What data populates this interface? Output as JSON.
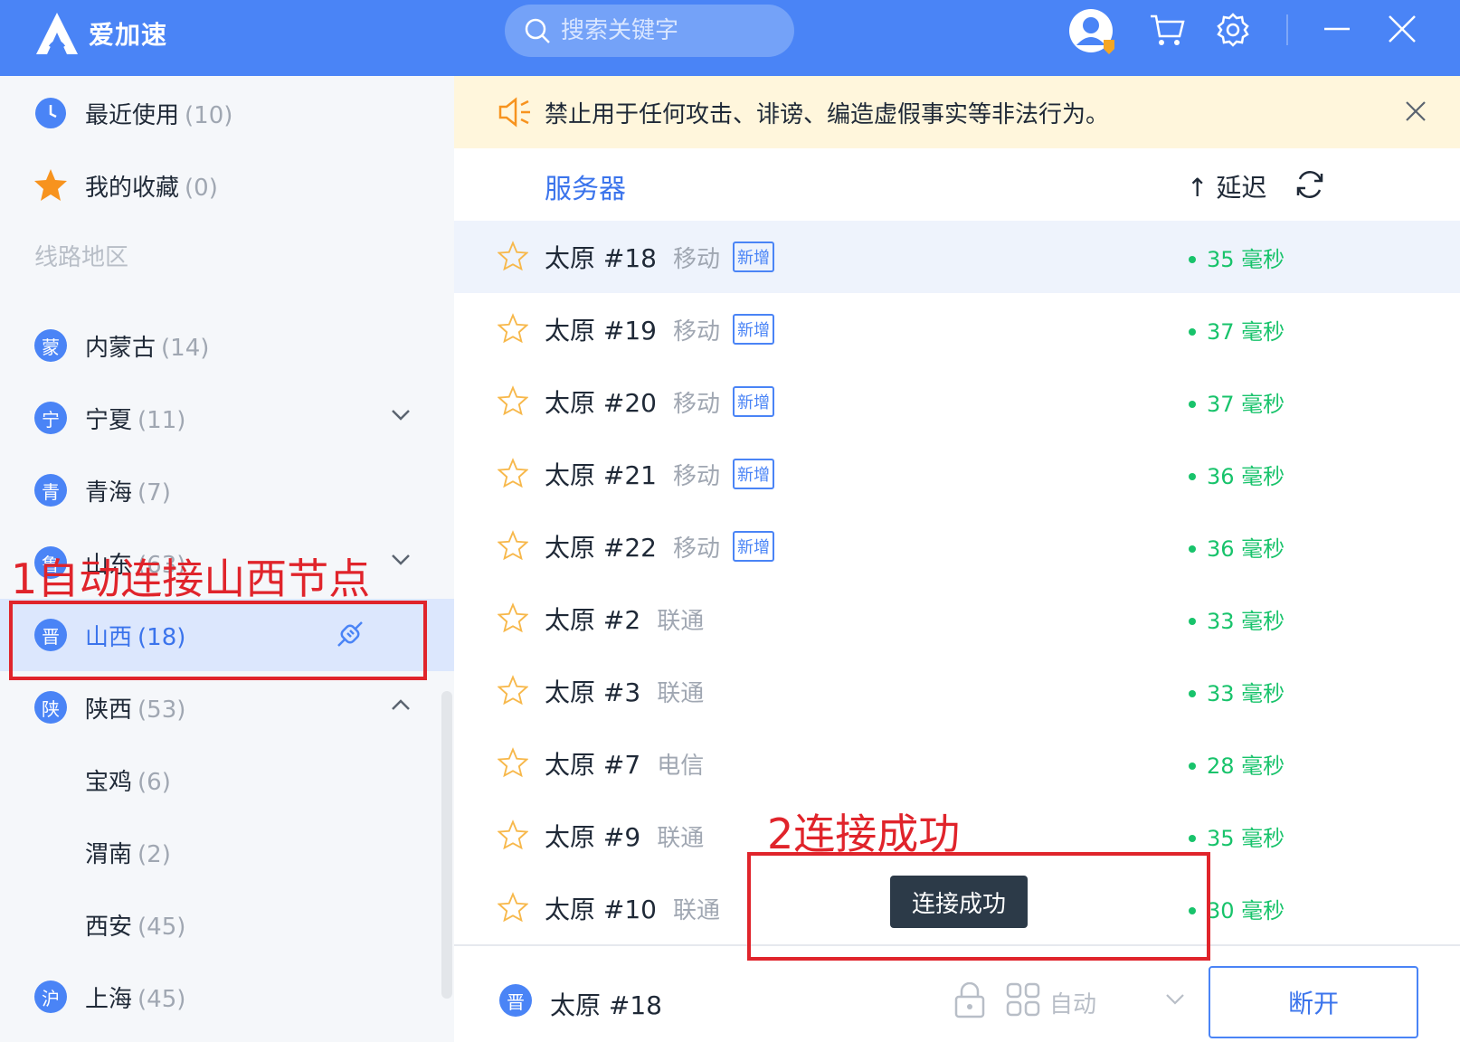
{
  "header": {
    "app_name": "爱加速",
    "search_placeholder": "搜索关键字"
  },
  "sidebar": {
    "recent": {
      "label": "最近使用",
      "count": "(10)"
    },
    "favorites": {
      "label": "我的收藏",
      "count": "(0)"
    },
    "section_title": "线路地区",
    "regions": [
      {
        "badge": "蒙",
        "label": "内蒙古",
        "count": "(14)"
      },
      {
        "badge": "宁",
        "label": "宁夏",
        "count": "(11)"
      },
      {
        "badge": "青",
        "label": "青海",
        "count": "(7)"
      },
      {
        "badge": "鲁",
        "label": "山东",
        "count": "(63)"
      },
      {
        "badge": "晋",
        "label": "山西",
        "count": "(18)"
      },
      {
        "badge": "陕",
        "label": "陕西",
        "count": "(53)"
      },
      {
        "badge": "沪",
        "label": "上海",
        "count": "(45)"
      }
    ],
    "sub_regions": [
      {
        "label": "宝鸡",
        "count": "(6)"
      },
      {
        "label": "渭南",
        "count": "(2)"
      },
      {
        "label": "西安",
        "count": "(45)"
      }
    ]
  },
  "notice": {
    "text": "禁止用于任何攻击、诽谤、编造虚假事实等非法行为。"
  },
  "columns": {
    "server": "服务器",
    "delay": "↑ 延迟"
  },
  "servers": [
    {
      "name": "太原 #18",
      "isp": "移动",
      "tag": "新增",
      "latency": "35 毫秒"
    },
    {
      "name": "太原 #19",
      "isp": "移动",
      "tag": "新增",
      "latency": "37 毫秒"
    },
    {
      "name": "太原 #20",
      "isp": "移动",
      "tag": "新增",
      "latency": "37 毫秒"
    },
    {
      "name": "太原 #21",
      "isp": "移动",
      "tag": "新增",
      "latency": "36 毫秒"
    },
    {
      "name": "太原 #22",
      "isp": "移动",
      "tag": "新增",
      "latency": "36 毫秒"
    },
    {
      "name": "太原 #2",
      "isp": "联通",
      "tag": "",
      "latency": "33 毫秒"
    },
    {
      "name": "太原 #3",
      "isp": "联通",
      "tag": "",
      "latency": "33 毫秒"
    },
    {
      "name": "太原 #7",
      "isp": "电信",
      "tag": "",
      "latency": "28 毫秒"
    },
    {
      "name": "太原 #9",
      "isp": "联通",
      "tag": "",
      "latency": "35 毫秒"
    },
    {
      "name": "太原 #10",
      "isp": "联通",
      "tag": "",
      "latency": "30 毫秒"
    }
  ],
  "bottom": {
    "badge": "晋",
    "current_server": "太原 #18",
    "mode": "自动",
    "disconnect_label": "断开"
  },
  "toast": {
    "text": "连接成功"
  },
  "annotations": {
    "step1": "1自动连接山西节点",
    "step2": "2连接成功"
  },
  "colors": {
    "primary": "#4a84f6",
    "success": "#18c36b",
    "annotation": "#e0242b"
  }
}
